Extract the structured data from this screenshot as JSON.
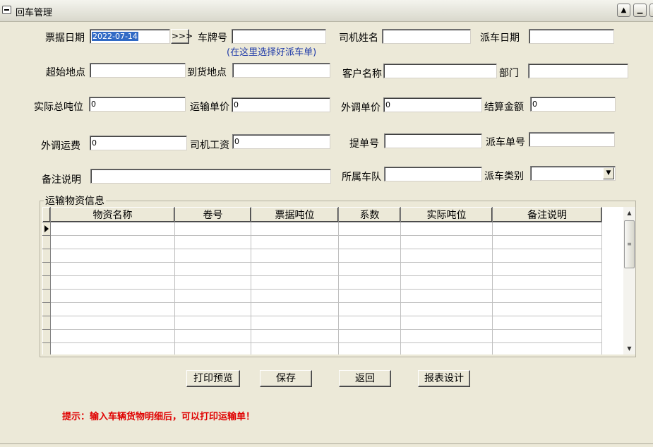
{
  "window": {
    "title": "回车管理"
  },
  "form": {
    "ticket_date_label": "票据日期",
    "ticket_date_value": "2022-07-14",
    "date_picker_button": ">>>",
    "plate_label": "车牌号",
    "plate_hint": "(在这里选择好派车单)",
    "driver_name_label": "司机姓名",
    "dispatch_date_label": "派车日期",
    "start_location_label": "超始地点",
    "arrival_location_label": "到货地点",
    "customer_name_label": "客户名称",
    "department_label": "部门",
    "actual_total_tonnage_label": "实际总吨位",
    "actual_total_tonnage_value": "0",
    "transport_unit_price_label": "运输单价",
    "transport_unit_price_value": "0",
    "outsource_unit_price_label": "外调单价",
    "outsource_unit_price_value": "0",
    "settlement_amount_label": "结算金额",
    "settlement_amount_value": "0",
    "outsource_freight_label": "外调运费",
    "outsource_freight_value": "0",
    "driver_wage_label": "司机工资",
    "driver_wage_value": "0",
    "bill_of_lading_label": "提单号",
    "dispatch_order_no_label": "派车单号",
    "remarks_label": "备注说明",
    "fleet_label": "所属车队",
    "dispatch_type_label": "派车类别"
  },
  "grid": {
    "group_title": "运输物资信息",
    "columns": [
      "物资名称",
      "卷号",
      "票据吨位",
      "系数",
      "实际吨位",
      "备注说明"
    ],
    "row_count": 10
  },
  "buttons": {
    "print_preview": "打印预览",
    "save": "保存",
    "back": "返回",
    "report_design": "报表设计"
  },
  "hint": {
    "text": "提示：输入车辆货物明细后，可以打印运输单！"
  }
}
